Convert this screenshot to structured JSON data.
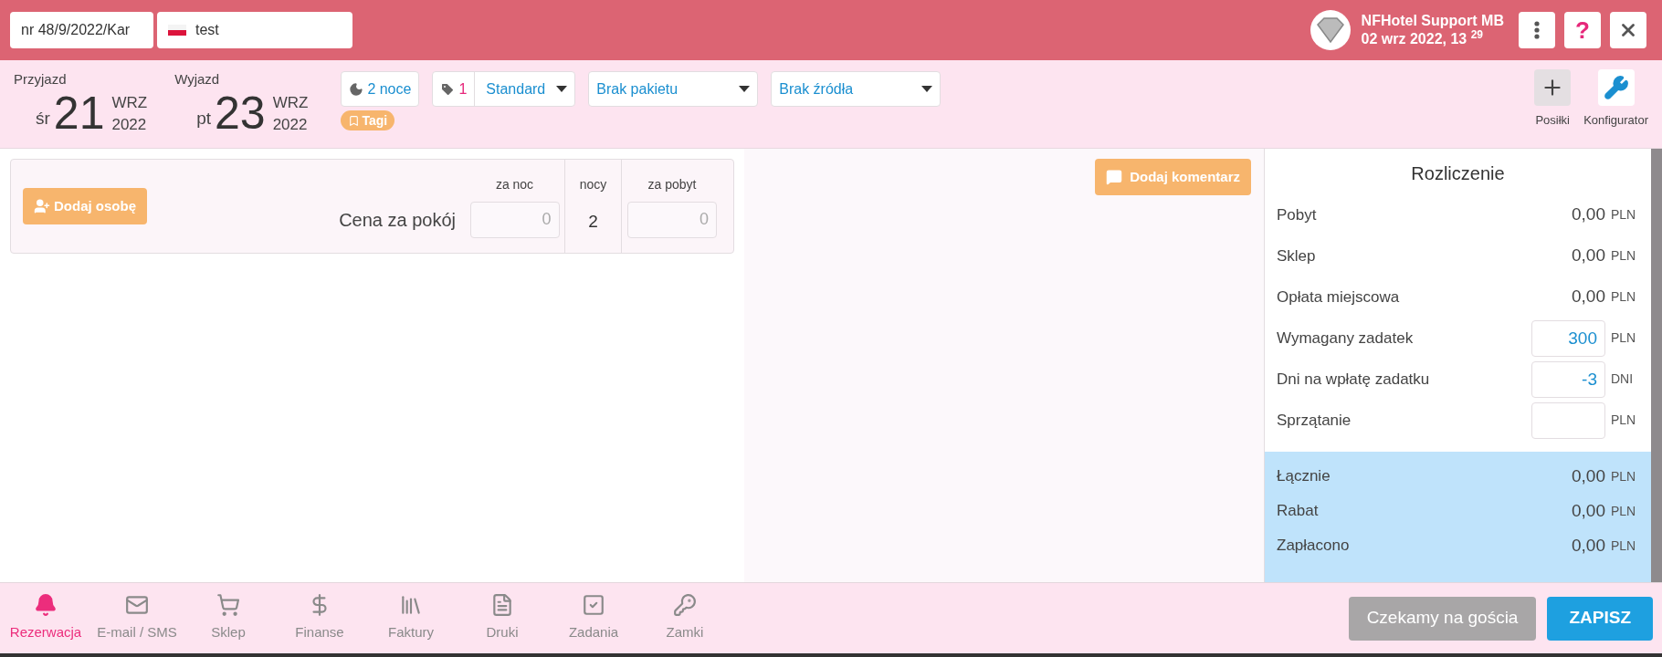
{
  "top_bar": {
    "reservation_number": "nr 48/9/2022/Kar",
    "guest_field": {
      "value": "test"
    },
    "user": {
      "name": "NFHotel Support MB",
      "datetime": "02 wrz 2022, 13 $^{29}$"
    },
    "icon_buttons": [
      {
        "kind": "menu"
      },
      {
        "kind": "help",
        "text": "?"
      },
      {
        "kind": "close"
      }
    ]
  },
  "header": {
    "arrival": {
      "label": "Przyjazd",
      "weekday": "śr",
      "day": "21",
      "month": "WRZ",
      "year": "2022"
    },
    "departure": {
      "label": "Wyjazd",
      "weekday": "pt",
      "day": "23",
      "month": "WRZ",
      "year": "2022"
    },
    "nights": "2 noce",
    "tag_count": "1",
    "room_type": "Standard",
    "package": "Brak pakietu",
    "source": "Brak źródła",
    "tags_button": "Tagi",
    "tools": [
      {
        "kind": "plus",
        "label": "Posiłki"
      },
      {
        "kind": "wrench",
        "label": "Konfigurator"
      }
    ]
  },
  "room_card": {
    "add_person": "Dodaj osobę",
    "columns": [
      "za noc",
      "nocy",
      "za pobyt"
    ],
    "row_label": "Cena za pokój",
    "per_night": {
      "placeholder": "0"
    },
    "nights": "2",
    "per_stay": {
      "placeholder": "0"
    }
  },
  "comment_button": "Dodaj komentarz",
  "settlement": {
    "title": "Rozliczenie",
    "rows": [
      {
        "kind": "amount",
        "label": "Pobyt",
        "value": "0,00",
        "unit": "PLN"
      },
      {
        "kind": "amount",
        "label": "Sklep",
        "value": "0,00",
        "unit": "PLN"
      },
      {
        "kind": "amount",
        "label": "Opłata miejscowa",
        "value": "0,00",
        "unit": "PLN"
      },
      {
        "kind": "input",
        "label": "Wymagany zadatek",
        "value": "300",
        "unit": "PLN"
      },
      {
        "kind": "input",
        "label": "Dni na wpłatę zadatku",
        "value": "-3",
        "unit": "DNI"
      },
      {
        "kind": "input",
        "label": "Sprzątanie",
        "unit": "PLN"
      }
    ],
    "summary": [
      {
        "label": "Łącznie",
        "value": "0,00",
        "unit": "PLN"
      },
      {
        "label": "Rabat",
        "value": "0,00",
        "unit": "PLN"
      },
      {
        "label": "Zapłacono",
        "value": "0,00",
        "unit": "PLN"
      }
    ]
  },
  "bottom_nav": [
    {
      "kind": "bell",
      "label": "Rezerwacja",
      "selected": true
    },
    {
      "kind": "mail",
      "label": "E-mail / SMS",
      "selected": false
    },
    {
      "kind": "cart",
      "label": "Sklep",
      "selected": false
    },
    {
      "kind": "dollar",
      "label": "Finanse",
      "selected": false
    },
    {
      "kind": "invoices",
      "label": "Faktury",
      "selected": false
    },
    {
      "kind": "document",
      "label": "Druki",
      "selected": false
    },
    {
      "kind": "check",
      "label": "Zadania",
      "selected": false
    },
    {
      "kind": "key",
      "label": "Zamki",
      "selected": false
    }
  ],
  "actions": {
    "wait_button": "Czekamy na gościa",
    "save_button": "ZAPISZ"
  }
}
